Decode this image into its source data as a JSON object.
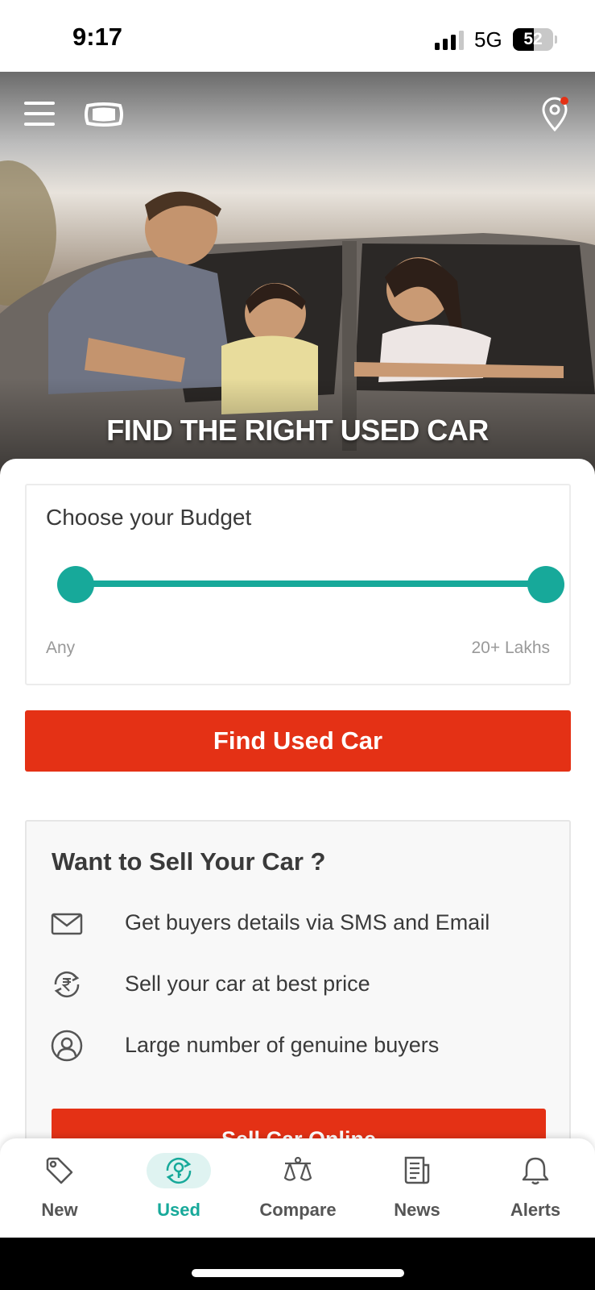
{
  "status_bar": {
    "time": "9:17",
    "network": "5G",
    "battery_level": "52",
    "battery_fraction": 0.52
  },
  "hero": {
    "title": "FIND THE RIGHT USED CAR",
    "location_badge_color": "#e43115"
  },
  "budget": {
    "title": "Choose your Budget",
    "min_label": "Any",
    "max_label": "20+ Lakhs",
    "range_fraction": [
      0,
      1
    ],
    "accent": "#17a99a"
  },
  "find_button": {
    "label": "Find Used Car",
    "color": "#e43115"
  },
  "sell": {
    "title": "Want to Sell Your Car ?",
    "features": [
      {
        "icon": "envelope-icon",
        "text": "Get buyers details via SMS and Email"
      },
      {
        "icon": "rupee-refresh-icon",
        "text": "Sell your car at best price"
      },
      {
        "icon": "user-circle-icon",
        "text": "Large number of genuine buyers"
      }
    ],
    "button_label": "Sell Car Online"
  },
  "bottom_nav": {
    "items": [
      {
        "label": "New",
        "icon": "tag-icon",
        "active": false
      },
      {
        "label": "Used",
        "icon": "key-refresh-icon",
        "active": true
      },
      {
        "label": "Compare",
        "icon": "scale-icon",
        "active": false
      },
      {
        "label": "News",
        "icon": "newspaper-icon",
        "active": false
      },
      {
        "label": "Alerts",
        "icon": "bell-icon",
        "active": false
      }
    ],
    "active_color": "#17a99a"
  }
}
